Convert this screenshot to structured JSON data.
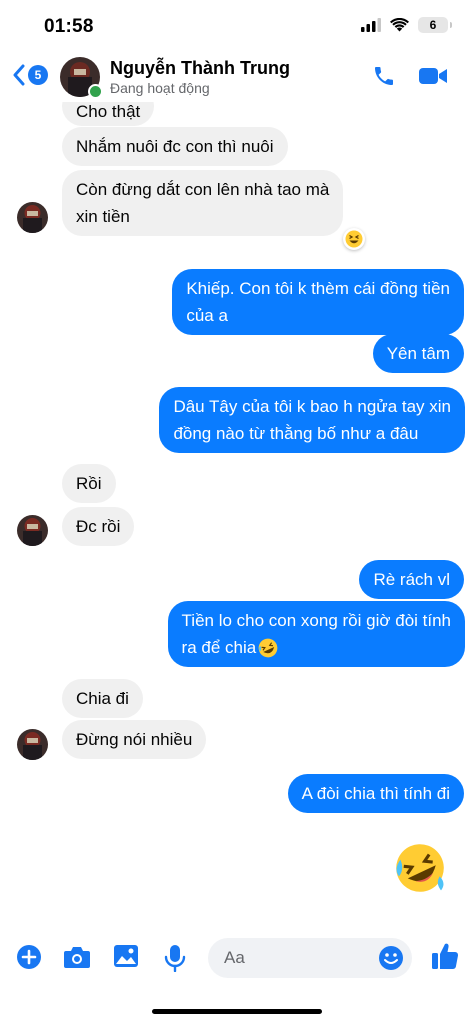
{
  "status_bar": {
    "time": "01:58",
    "battery": "6"
  },
  "header": {
    "unread_count": "5",
    "contact_name": "Nguyễn Thành Trung",
    "contact_status": "Đang hoạt động"
  },
  "messages": [
    {
      "from": "contact",
      "text": "Cho thật"
    },
    {
      "from": "contact",
      "text": "Nhắm nuôi đc con thì nuôi"
    },
    {
      "from": "contact",
      "lines": [
        "Còn đừng dắt con lên nhà tao mà",
        "xin tiền"
      ],
      "reaction": "grinning-squint-face"
    },
    {
      "from": "me",
      "lines": [
        "Khiếp. Con tôi k thèm cái đồng tiền",
        "của a"
      ]
    },
    {
      "from": "me",
      "text": "Yên tâm"
    },
    {
      "from": "me",
      "lines": [
        "Dâu Tây của tôi k bao h ngửa tay xin",
        "đồng nào từ thằng bố như a đâu"
      ]
    },
    {
      "from": "contact",
      "text": "Rồi"
    },
    {
      "from": "contact",
      "text": "Đc rồi"
    },
    {
      "from": "me",
      "text": "Rè rách vl"
    },
    {
      "from": "me",
      "lines": [
        "Tiền lo cho con xong rồi giờ đòi tính",
        "ra để chia"
      ],
      "emoji": "rofl-face"
    },
    {
      "from": "contact",
      "text": "Chia đi"
    },
    {
      "from": "contact",
      "text": "Đừng nói nhiều"
    },
    {
      "from": "me",
      "text": "A đòi chia thì tính đi"
    },
    {
      "from": "me",
      "emoji": "rofl-face",
      "large": true
    }
  ],
  "composer": {
    "placeholder": "Aa"
  },
  "colors": {
    "accent": "#0a7cff",
    "incoming_bubble": "#f0f0f0",
    "online": "#31a24c"
  }
}
